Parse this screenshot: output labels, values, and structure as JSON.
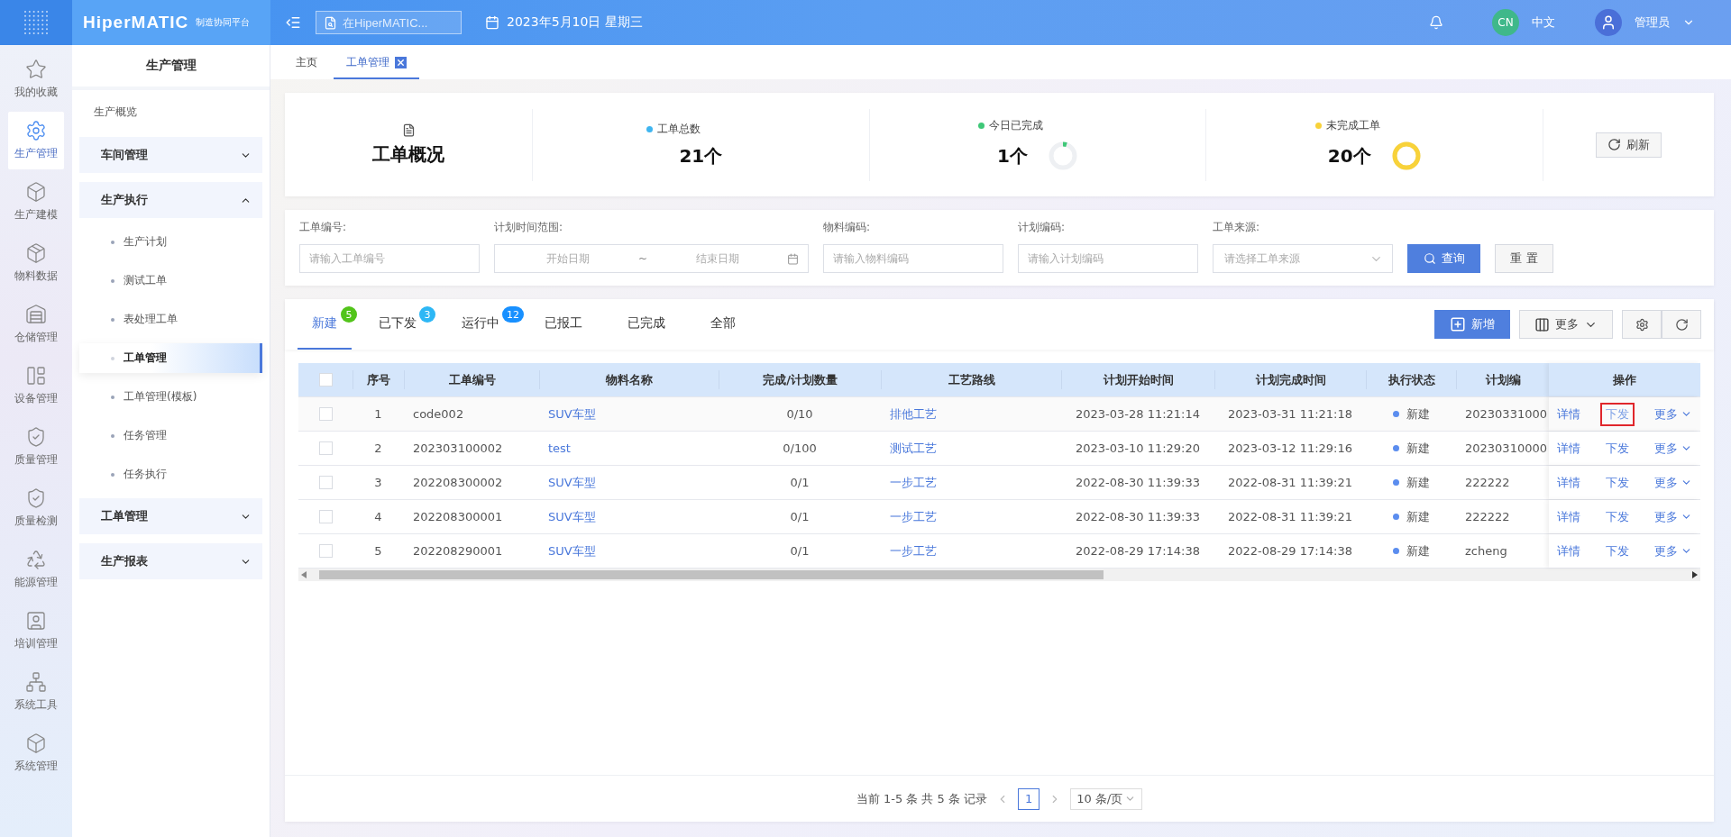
{
  "header": {
    "logo": "HiperMATIC",
    "logo_sub": "制造协同平台",
    "search": {
      "placeholder": "在HiperMATIC..."
    },
    "date": "2023年5月10日 星期三",
    "lang_badge": "CN",
    "lang": "中文",
    "user": "管理员"
  },
  "rail": [
    {
      "label": "我的收藏",
      "selected": false
    },
    {
      "label": "生产管理",
      "selected": true
    },
    {
      "label": "生产建模",
      "selected": false
    },
    {
      "label": "物料数据",
      "selected": false
    },
    {
      "label": "仓储管理",
      "selected": false
    },
    {
      "label": "设备管理",
      "selected": false
    },
    {
      "label": "质量管理",
      "selected": false
    },
    {
      "label": "质量检测",
      "selected": false
    },
    {
      "label": "能源管理",
      "selected": false
    },
    {
      "label": "培训管理",
      "selected": false
    },
    {
      "label": "系统工具",
      "selected": false
    },
    {
      "label": "系统管理",
      "selected": false
    }
  ],
  "nav": {
    "title": "生产管理",
    "items": [
      {
        "kind": "link",
        "label": "生产概览"
      },
      {
        "kind": "group",
        "label": "车间管理",
        "expanded": false
      },
      {
        "kind": "group",
        "label": "生产执行",
        "expanded": true,
        "children": [
          {
            "label": "生产计划",
            "selected": false
          },
          {
            "label": "测试工单",
            "selected": false
          },
          {
            "label": "表处理工单",
            "selected": false
          },
          {
            "label": "工单管理",
            "selected": true
          },
          {
            "label": "工单管理(模板)",
            "selected": false
          },
          {
            "label": "任务管理",
            "selected": false
          },
          {
            "label": "任务执行",
            "selected": false
          }
        ]
      },
      {
        "kind": "group",
        "label": "工单管理",
        "expanded": false
      },
      {
        "kind": "group",
        "label": "生产报表",
        "expanded": false
      }
    ]
  },
  "page_tabs": [
    {
      "label": "主页",
      "selected": false,
      "closable": false
    },
    {
      "label": "工单管理",
      "selected": true,
      "closable": true
    }
  ],
  "summary": {
    "title": "工单概况",
    "stats": [
      {
        "label": "工单总数",
        "value": "21个",
        "color": "#3fb5f0"
      },
      {
        "label": "今日已完成",
        "value": "1个",
        "color": "#3fc878",
        "ring": {
          "level": 0.05
        }
      },
      {
        "label": "未完成工单",
        "value": "20个",
        "color": "#f8d23a",
        "ring": {
          "level": 1
        }
      }
    ],
    "refresh": "刷新"
  },
  "filters": {
    "fields": [
      {
        "kind": "text",
        "label": "工单编号:",
        "placeholder": "请输入工单编号"
      },
      {
        "kind": "daterange",
        "label": "计划时间范围:",
        "start_placeholder": "开始日期",
        "separator": "~",
        "end_placeholder": "结束日期"
      },
      {
        "kind": "text",
        "label": "物料编码:",
        "placeholder": "请输入物料编码"
      },
      {
        "kind": "text",
        "label": "计划编码:",
        "placeholder": "请输入计划编码"
      },
      {
        "kind": "select",
        "label": "工单来源:",
        "placeholder": "请选择工单来源"
      }
    ],
    "search_button": "查询",
    "reset_button": "重 置"
  },
  "status_tabs": [
    {
      "label": "新建",
      "selected": true,
      "badge": "5",
      "color": "#52c41a"
    },
    {
      "label": "已下发",
      "selected": false,
      "badge": "3",
      "color": "#2db7f5"
    },
    {
      "label": "运行中",
      "selected": false,
      "badge": "12",
      "color": "#1890ff"
    },
    {
      "label": "已报工",
      "selected": false
    },
    {
      "label": "已完成",
      "selected": false
    },
    {
      "label": "全部",
      "selected": false
    }
  ],
  "toolbar": {
    "add": "新增",
    "more": "更多"
  },
  "table": {
    "all_checked": false,
    "columns": [
      "序号",
      "工单编号",
      "物料名称",
      "完成/计划数量",
      "工艺路线",
      "计划开始时间",
      "计划完成时间",
      "执行状态",
      "计划编",
      "操作"
    ],
    "rows": [
      {
        "checked": false,
        "no": "1",
        "code": "code002",
        "material": "SUV车型",
        "qty": "0/10",
        "route": "排他工艺",
        "start": "2023-03-28 11:21:14",
        "end": "2023-03-31 11:21:18",
        "status": "新建",
        "plan": "20230331000",
        "actions": [
          {
            "label": "详情",
            "highlighted": false
          },
          {
            "label": "下发",
            "highlighted": true
          },
          {
            "label": "更多",
            "highlighted": false
          }
        ]
      },
      {
        "checked": false,
        "no": "2",
        "code": "202303100002",
        "material": "test",
        "qty": "0/100",
        "route": "测试工艺",
        "start": "2023-03-10 11:29:20",
        "end": "2023-03-12 11:29:16",
        "status": "新建",
        "plan": "20230310000",
        "actions": [
          {
            "label": "详情",
            "highlighted": false
          },
          {
            "label": "下发",
            "highlighted": false
          },
          {
            "label": "更多",
            "highlighted": false
          }
        ]
      },
      {
        "checked": false,
        "no": "3",
        "code": "202208300002",
        "material": "SUV车型",
        "qty": "0/1",
        "route": "一步工艺",
        "start": "2022-08-30 11:39:33",
        "end": "2022-08-31 11:39:21",
        "status": "新建",
        "plan": "222222",
        "actions": [
          {
            "label": "详情",
            "highlighted": false
          },
          {
            "label": "下发",
            "highlighted": false
          },
          {
            "label": "更多",
            "highlighted": false
          }
        ]
      },
      {
        "checked": false,
        "no": "4",
        "code": "202208300001",
        "material": "SUV车型",
        "qty": "0/1",
        "route": "一步工艺",
        "start": "2022-08-30 11:39:33",
        "end": "2022-08-31 11:39:21",
        "status": "新建",
        "plan": "222222",
        "actions": [
          {
            "label": "详情",
            "highlighted": false
          },
          {
            "label": "下发",
            "highlighted": false
          },
          {
            "label": "更多",
            "highlighted": false
          }
        ]
      },
      {
        "checked": false,
        "no": "5",
        "code": "202208290001",
        "material": "SUV车型",
        "qty": "0/1",
        "route": "一步工艺",
        "start": "2022-08-29 17:14:38",
        "end": "2022-08-29 17:14:38",
        "status": "新建",
        "plan": "zcheng",
        "actions": [
          {
            "label": "详情",
            "highlighted": false
          },
          {
            "label": "下发",
            "highlighted": false
          },
          {
            "label": "更多",
            "highlighted": false
          }
        ]
      }
    ]
  },
  "pagination": {
    "summary": "当前 1-5 条 共 5 条 记录",
    "pages": [
      {
        "label": "1",
        "selected": true
      }
    ],
    "page_size": "10 条/页"
  }
}
